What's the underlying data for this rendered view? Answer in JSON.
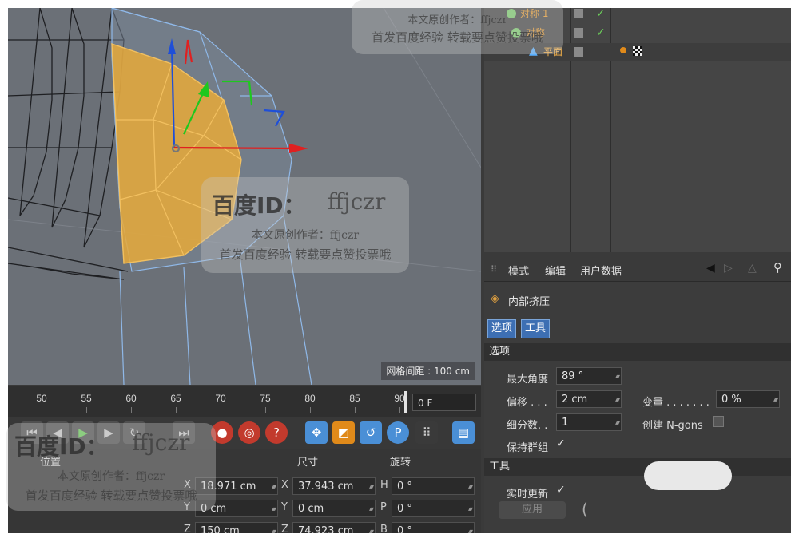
{
  "viewport": {
    "grid_spacing_label": "网格间距 : 100 cm"
  },
  "timeline": {
    "ticks": [
      "50",
      "55",
      "60",
      "65",
      "70",
      "75",
      "80",
      "85",
      "90"
    ],
    "current_frame": "0 F"
  },
  "transport": {
    "icons": [
      "go-start-icon",
      "prev-key-icon",
      "play-icon",
      "next-key-icon",
      "loop-icon",
      "go-end-icon",
      "record-icon",
      "autokey-icon",
      "keyframe-help-icon",
      "move-icon",
      "scale-icon",
      "rotate-icon",
      "param-icon",
      "grid-points-icon",
      "film-icon"
    ]
  },
  "coords": {
    "headers": {
      "position": "位置",
      "size": "尺寸",
      "rotation": "旋转"
    },
    "rows": [
      {
        "axis": "X",
        "position": "18.971 cm",
        "size_axis": "X",
        "size": "37.943 cm",
        "rot_axis": "H",
        "rotation": "0 °"
      },
      {
        "axis": "Y",
        "position": "0 cm",
        "size_axis": "Y",
        "size": "0 cm",
        "rot_axis": "P",
        "rotation": "0 °"
      },
      {
        "axis": "Z",
        "position": "150 cm",
        "size_axis": "Z",
        "size": "74.923 cm",
        "rot_axis": "B",
        "rotation": "0 °"
      }
    ]
  },
  "object_manager": {
    "objects": [
      {
        "name": "对称 1",
        "check": "✓"
      },
      {
        "name": "对称",
        "check": "✓"
      },
      {
        "name": "平面",
        "check": ""
      }
    ]
  },
  "attributes": {
    "menu": [
      "模式",
      "编辑",
      "用户数据"
    ],
    "tool_title": "内部挤压",
    "tabs": [
      "选项",
      "工具"
    ],
    "options_section": "选项",
    "max_angle_label": "最大角度",
    "max_angle_value": "89 °",
    "offset_label": "偏移 . . .",
    "offset_value": "2 cm",
    "variance_label": "变量 . . . . . . .",
    "variance_value": "0 %",
    "subdivisions_label": "细分数. .",
    "subdivisions_value": "1",
    "create_ngons_label": "创建 N-gons",
    "preserve_groups_label": "保持群组",
    "preserve_groups_check": "✓",
    "tool_section": "工具",
    "realtime_label": "实时更新",
    "realtime_check": "✓",
    "apply_label": "应用"
  },
  "watermarks": {
    "id_text": "百度ID：",
    "id_value": "ffjczr",
    "author_line": "本文原创作者：ffjczr",
    "promo_line": "首发百度经验 转载要点赞投票哦"
  },
  "colors": {
    "selection": "#e8a93a",
    "accent_blue": "#3d6fb3",
    "object_name": "#f0a030",
    "check_green": "#6ccf5a"
  }
}
